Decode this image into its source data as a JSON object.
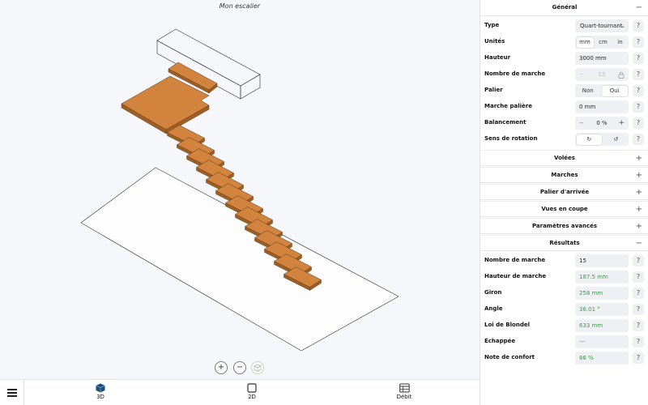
{
  "viewport": {
    "title": "Mon escalier",
    "zoom_in": "+",
    "zoom_out": "−"
  },
  "bottom_nav": [
    {
      "label": "3D",
      "icon": "cube-icon"
    },
    {
      "label": "2D",
      "icon": "square-icon"
    },
    {
      "label": "Débit",
      "icon": "table-icon"
    }
  ],
  "general": {
    "title": "Général",
    "toggle": "−",
    "type": {
      "label": "Type",
      "value": "Quart-tournant"
    },
    "units": {
      "label": "Unités",
      "options": [
        "mm",
        "cm",
        "in"
      ],
      "selected": "mm"
    },
    "height": {
      "label": "Hauteur",
      "value": "3000 mm"
    },
    "steps": {
      "label": "Nombre de marche",
      "minus": "−",
      "value": "15"
    },
    "landing": {
      "label": "Palier",
      "options": [
        "Non",
        "Oui"
      ],
      "selected": "Oui"
    },
    "landing_step": {
      "label": "Marche palière",
      "value": "0 mm"
    },
    "balance": {
      "label": "Balancement",
      "minus": "−",
      "value": "0 %",
      "plus": "+"
    },
    "rotation": {
      "label": "Sens de rotation",
      "options": [
        "↻",
        "↺"
      ],
      "selected": "↻"
    }
  },
  "sections": [
    {
      "label": "Volées",
      "toggle": "+"
    },
    {
      "label": "Marches",
      "toggle": "+"
    },
    {
      "label": "Palier d'arrivée",
      "toggle": "+"
    },
    {
      "label": "Vues en coupe",
      "toggle": "+"
    },
    {
      "label": "Paramètres avancés",
      "toggle": "+"
    }
  ],
  "results": {
    "title": "Résultats",
    "toggle": "−",
    "rows": [
      {
        "label": "Nombre de marche",
        "value": "15",
        "green": false
      },
      {
        "label": "Hauteur de marche",
        "value": "187.5 mm",
        "green": true
      },
      {
        "label": "Giron",
        "value": "258 mm",
        "green": true
      },
      {
        "label": "Angle",
        "value": "36.01 °",
        "green": true
      },
      {
        "label": "Loi de Blondel",
        "value": "633 mm",
        "green": true
      },
      {
        "label": "Echappée",
        "value": "---",
        "green": true
      },
      {
        "label": "Note de confort",
        "value": "86 %",
        "green": true
      }
    ]
  },
  "help_glyph": "?",
  "colors": {
    "tread": "#d2843f",
    "tread_side": "#9e5e24",
    "result_green": "#3f9a4e"
  }
}
